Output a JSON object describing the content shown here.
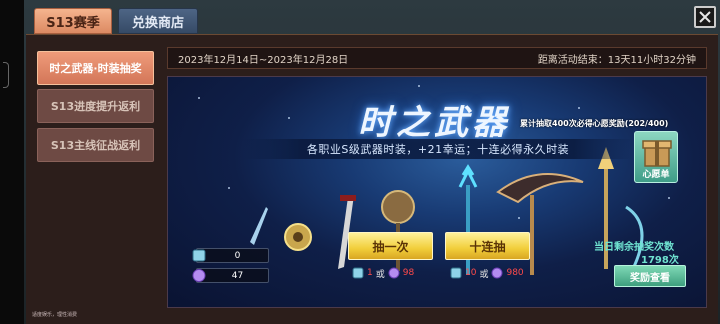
{
  "tabs": {
    "season": "S13赛季",
    "shop": "兑换商店"
  },
  "sidebar": {
    "items": [
      {
        "label": "时之武器·时装抽奖"
      },
      {
        "label": "S13进度提升返利"
      },
      {
        "label": "S13主线征战返利"
      }
    ]
  },
  "event": {
    "date_range": "2023年12月14日~2023年12月28日",
    "countdown": "距离活动结束：13天11小时32分钟"
  },
  "banner": {
    "title": "时之武器",
    "progress": "累计抽取400次必得心愿奖励(202/400)",
    "subtitle": "各职业S级武器时装，+21幸运；十连必得永久时装",
    "wish_label": "心愿单"
  },
  "currency": {
    "ticket_count": "0",
    "gem_count": "47"
  },
  "draw": {
    "single_label": "抽一次",
    "single_ticket": "1",
    "single_gem": "98",
    "ten_label": "十连抽",
    "ten_ticket": "10",
    "ten_gem": "980",
    "or_text": "或"
  },
  "reward": {
    "remain_label": "当日剩余抽奖次数",
    "remain_count": "1798次",
    "view_label": "奖励查看"
  },
  "footer": {
    "note": "适度娱乐，理性消费"
  },
  "colors": {
    "accent": "#ef9b7a",
    "panel": "#2c1e1b",
    "gold_button": "#f1ce3a",
    "teal_button": "#3e9f7e",
    "cost_red": "#ff4a4a"
  }
}
